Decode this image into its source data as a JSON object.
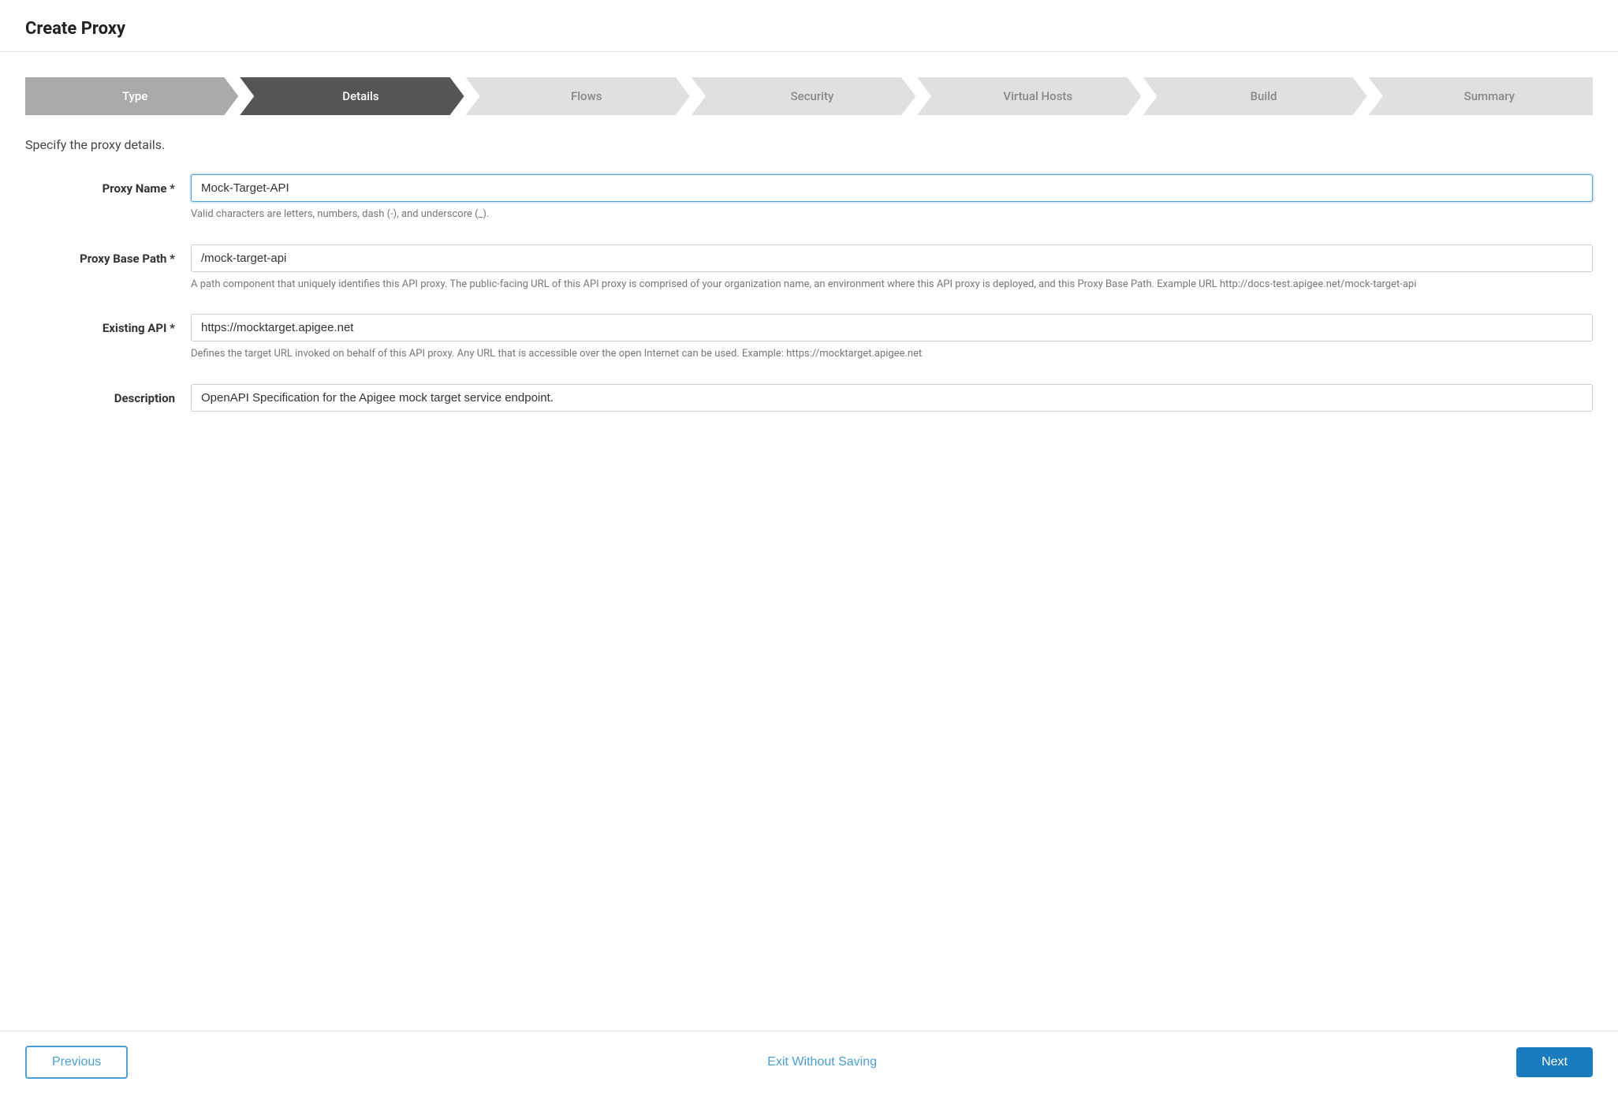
{
  "page": {
    "title": "Create Proxy"
  },
  "stepper": {
    "steps": [
      {
        "id": "type",
        "label": "Type",
        "state": "completed"
      },
      {
        "id": "details",
        "label": "Details",
        "state": "active"
      },
      {
        "id": "flows",
        "label": "Flows",
        "state": "inactive"
      },
      {
        "id": "security",
        "label": "Security",
        "state": "inactive"
      },
      {
        "id": "virtual-hosts",
        "label": "Virtual Hosts",
        "state": "inactive"
      },
      {
        "id": "build",
        "label": "Build",
        "state": "inactive"
      },
      {
        "id": "summary",
        "label": "Summary",
        "state": "inactive"
      }
    ]
  },
  "form": {
    "section_description": "Specify the proxy details.",
    "proxy_name": {
      "label": "Proxy Name",
      "required": true,
      "value": "Mock-Target-API",
      "hint": "Valid characters are letters, numbers, dash (-), and underscore (_)."
    },
    "proxy_base_path": {
      "label": "Proxy Base Path",
      "required": true,
      "value": "/mock-target-api",
      "hint": "A path component that uniquely identifies this API proxy. The public-facing URL of this API proxy is comprised of your organization name, an environment where this API proxy is deployed, and this Proxy Base Path. Example URL http://docs-test.apigee.net/mock-target-api"
    },
    "existing_api": {
      "label": "Existing API",
      "required": true,
      "value": "https://mocktarget.apigee.net",
      "hint": "Defines the target URL invoked on behalf of this API proxy. Any URL that is accessible over the open Internet can be used. Example: https://mocktarget.apigee.net"
    },
    "description": {
      "label": "Description",
      "required": false,
      "value": "OpenAPI Specification for the Apigee mock target service endpoint.",
      "hint": ""
    }
  },
  "footer": {
    "previous_label": "Previous",
    "exit_label": "Exit Without Saving",
    "next_label": "Next"
  }
}
